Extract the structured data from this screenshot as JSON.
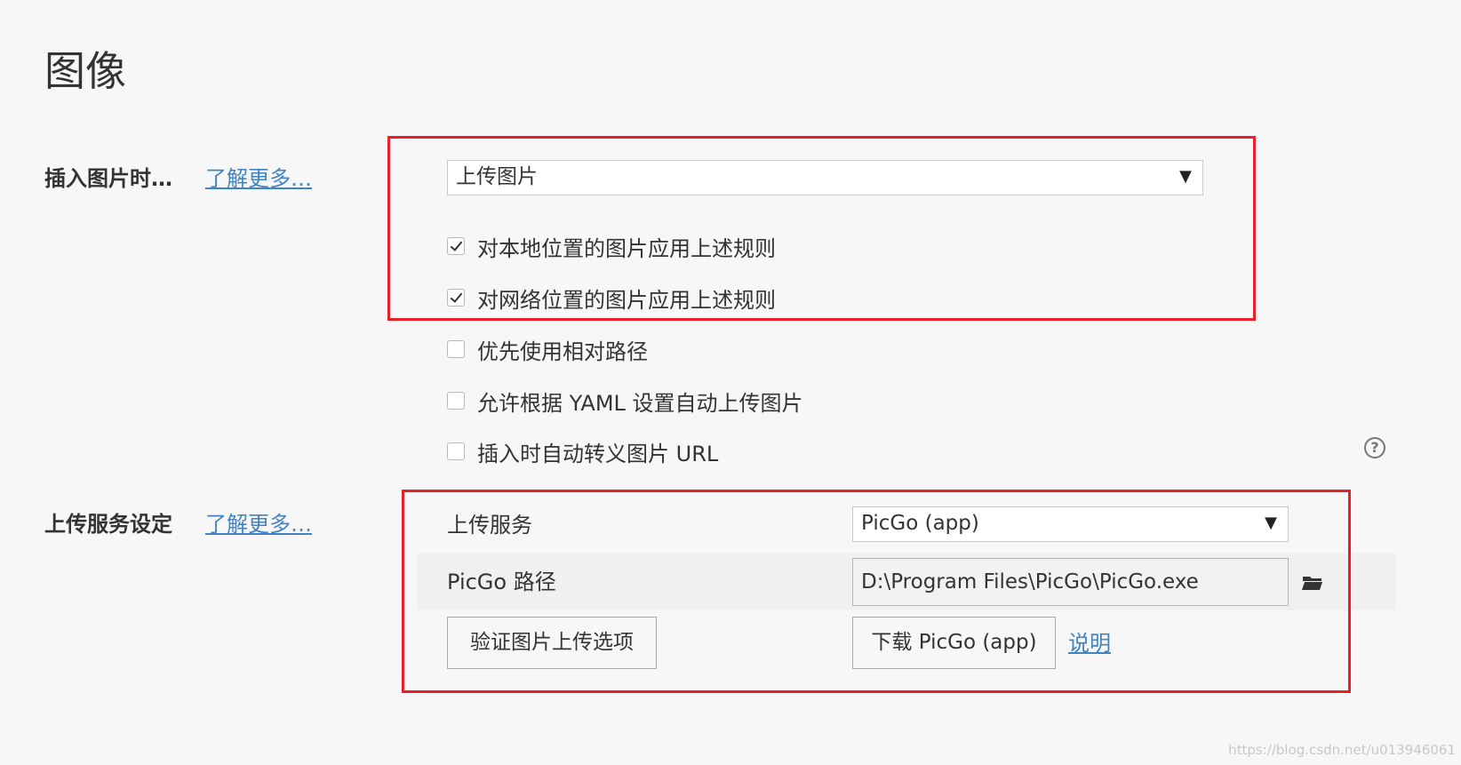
{
  "page": {
    "title": "图像"
  },
  "insert_section": {
    "label": "插入图片时…",
    "learn_more": "了解更多…",
    "action_select": {
      "value": "上传图片"
    },
    "options": [
      {
        "label": "对本地位置的图片应用上述规则",
        "checked": true
      },
      {
        "label": "对网络位置的图片应用上述规则",
        "checked": true
      },
      {
        "label": "优先使用相对路径",
        "checked": false
      },
      {
        "label": "允许根据 YAML 设置自动上传图片",
        "checked": false
      },
      {
        "label": "插入时自动转义图片 URL",
        "checked": false
      }
    ]
  },
  "upload_section": {
    "label": "上传服务设定",
    "learn_more": "了解更多…",
    "service_label": "上传服务",
    "service_value": "PicGo (app)",
    "path_label": "PicGo 路径",
    "path_value": "D:\\Program Files\\PicGo\\PicGo.exe",
    "verify_button": "验证图片上传选项",
    "download_button": "下载 PicGo (app)",
    "explain_link": "说明"
  },
  "icons": {
    "dropdown": "▼",
    "help": "?",
    "folder": "folder-icon"
  },
  "colors": {
    "highlight_border": "#e8202a",
    "link": "#4183c4"
  },
  "watermark": "https://blog.csdn.net/u013946061"
}
